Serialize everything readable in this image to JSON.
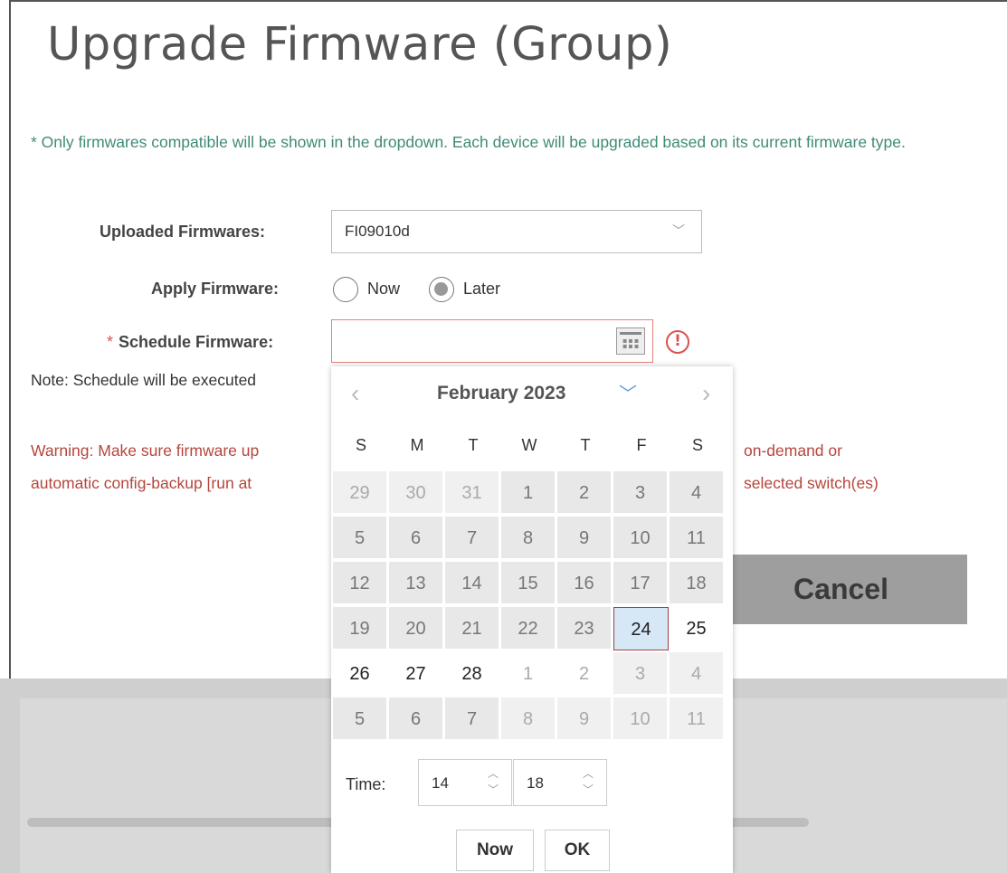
{
  "modal": {
    "title": "Upgrade Firmware (Group)",
    "info_text": "* Only firmwares compatible will be shown in the dropdown. Each device will be upgraded based on its current firmware type.",
    "uploaded_label": "Uploaded Firmwares:",
    "uploaded_value": "FI09010d",
    "apply_label": "Apply Firmware:",
    "apply_options": [
      "Now",
      "Later"
    ],
    "apply_selected": "Later",
    "schedule_label": "Schedule Firmware:",
    "schedule_required": "*",
    "schedule_value": "",
    "error_icon": "!",
    "note": "Note: Schedule will be executed",
    "warning_line1": "Warning: Make sure firmware up",
    "warning_line1_end": "on-demand or",
    "warning_line2": "automatic config-backup [run at",
    "warning_line2_end": "selected switch(es)",
    "cancel_label": "Cancel"
  },
  "datepicker": {
    "prev": "‹",
    "next": "›",
    "month_label": "February 2023",
    "month_dropdown_icon": "chevron-down-icon",
    "weekdays": [
      "S",
      "M",
      "T",
      "W",
      "T",
      "F",
      "S"
    ],
    "weeks": [
      [
        "29",
        "30",
        "31",
        "1",
        "2",
        "3",
        "4"
      ],
      [
        "5",
        "6",
        "7",
        "8",
        "9",
        "10",
        "11"
      ],
      [
        "12",
        "13",
        "14",
        "15",
        "16",
        "17",
        "18"
      ],
      [
        "19",
        "20",
        "21",
        "22",
        "23",
        "24",
        "25"
      ],
      [
        "26",
        "27",
        "28",
        "1",
        "2",
        "3",
        "4"
      ],
      [
        "5",
        "6",
        "7",
        "8",
        "9",
        "10",
        "11"
      ]
    ],
    "selected_day": "24",
    "time_label": "Time:",
    "hour": "14",
    "minute": "18",
    "now_label": "Now",
    "ok_label": "OK"
  }
}
